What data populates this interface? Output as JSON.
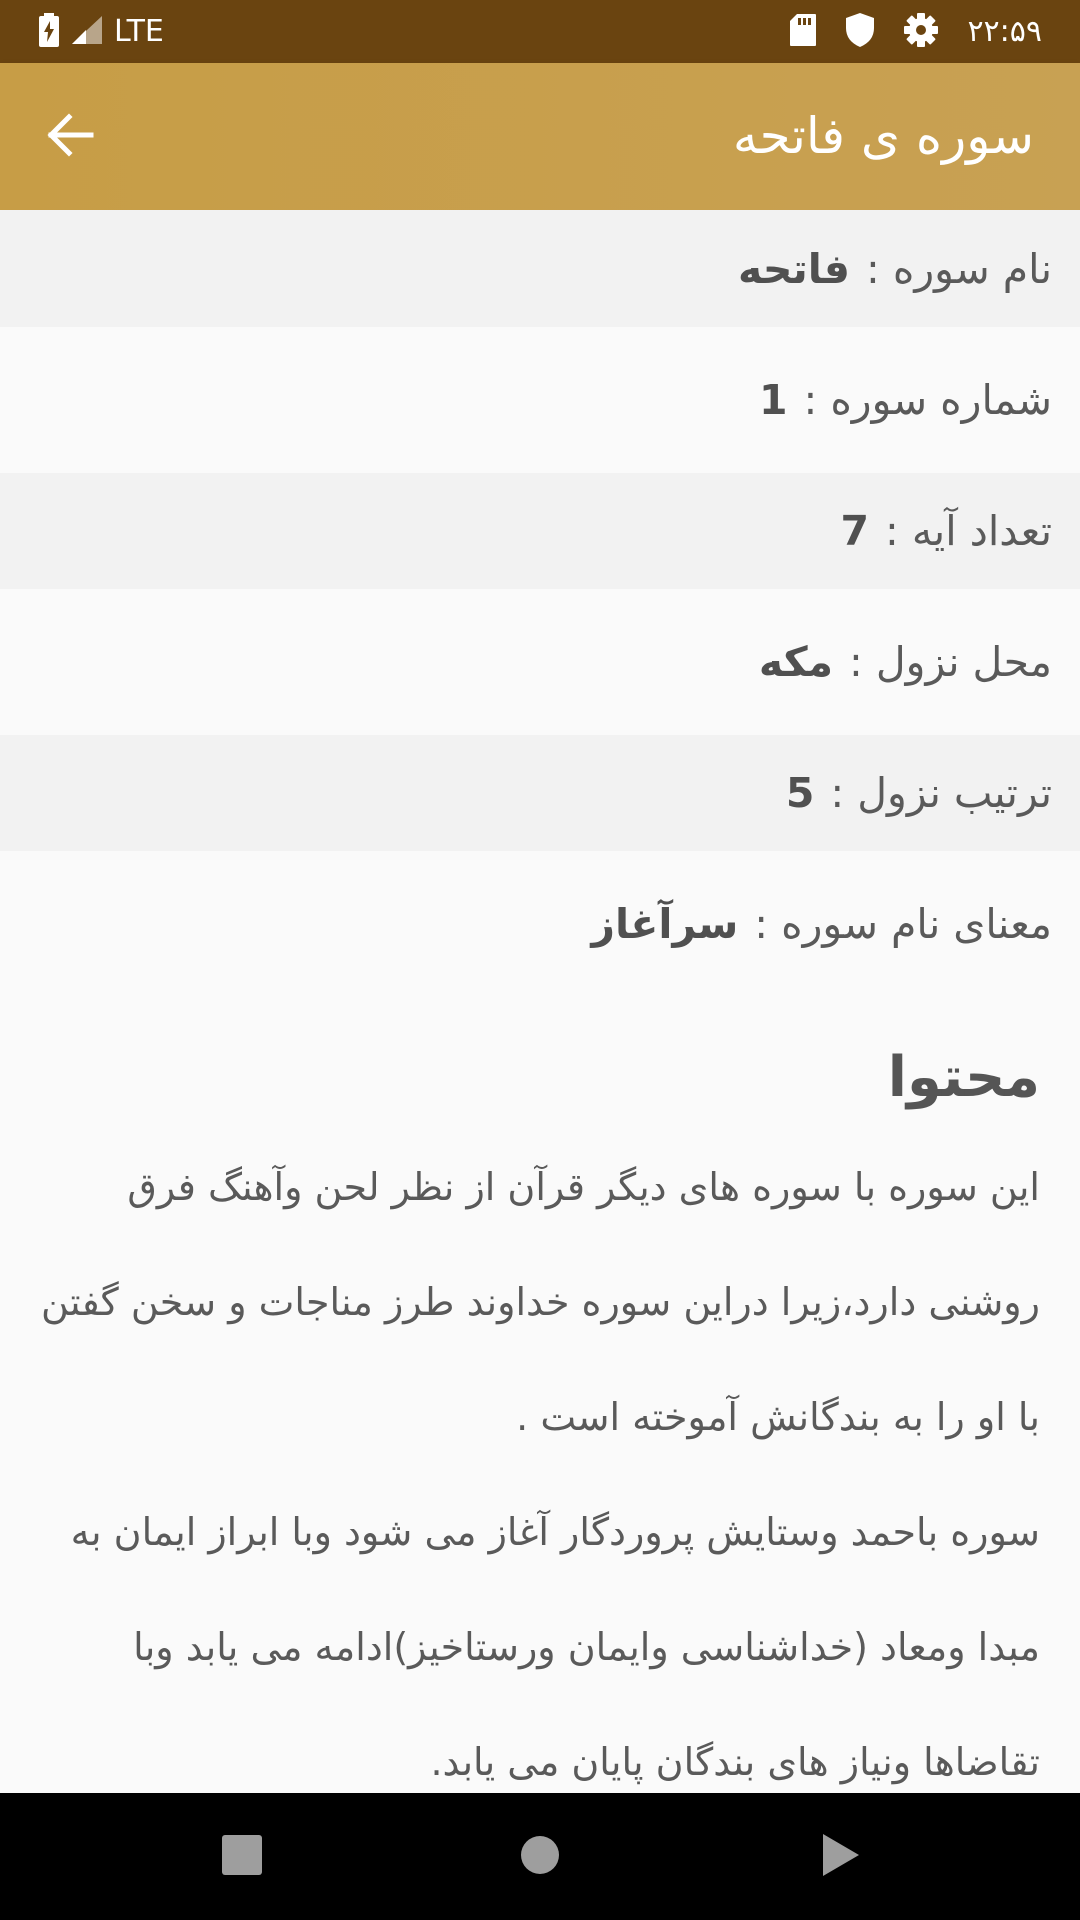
{
  "status_bar": {
    "network": "LTE",
    "time": "۲۲:۵۹"
  },
  "app_bar": {
    "title": "سوره ی فاتحه"
  },
  "info": {
    "name_label": "نام سوره :",
    "name_value": "فاتحه",
    "number_label": "شماره سوره :",
    "number_value": "1",
    "verses_label": "تعداد آیه :",
    "verses_value": "7",
    "place_label": "محل نزول :",
    "place_value": "مکه",
    "order_label": "ترتیب نزول :",
    "order_value": "5",
    "meaning_label": "معنای نام سوره :",
    "meaning_value": "سرآغاز"
  },
  "content": {
    "section_title": "محتوا",
    "paragraph_1": "این سوره با سوره های دیگر قرآن از نظر لحن وآهنگ فرق روشنی دارد،زیرا دراین سوره خداوند طرز مناجات و سخن گفتن با او  را به بندگانش آموخته است .",
    "paragraph_2": "سوره باحمد وستایش پروردگار آغاز می شود وبا ابراز ایمان به مبدا ومعاد (خداشناسی وایمان ورستاخیز)ادامه می یابد وبا تقاضاها ونیاز های بندگان پایان می یابد."
  },
  "icons": {
    "battery": "battery-charging-icon",
    "signal": "signal-icon",
    "sd": "sd-card-icon",
    "shield": "shield-icon",
    "settings": "gear-icon",
    "back": "arrow-back-icon",
    "nav_recents": "square-icon",
    "nav_home": "circle-icon",
    "nav_back": "triangle-back-icon"
  },
  "colors": {
    "status_bar": "#6a4410",
    "app_bar": "#c8a050",
    "row_shade": "#f2f2f2",
    "text": "#5a5a5a"
  }
}
